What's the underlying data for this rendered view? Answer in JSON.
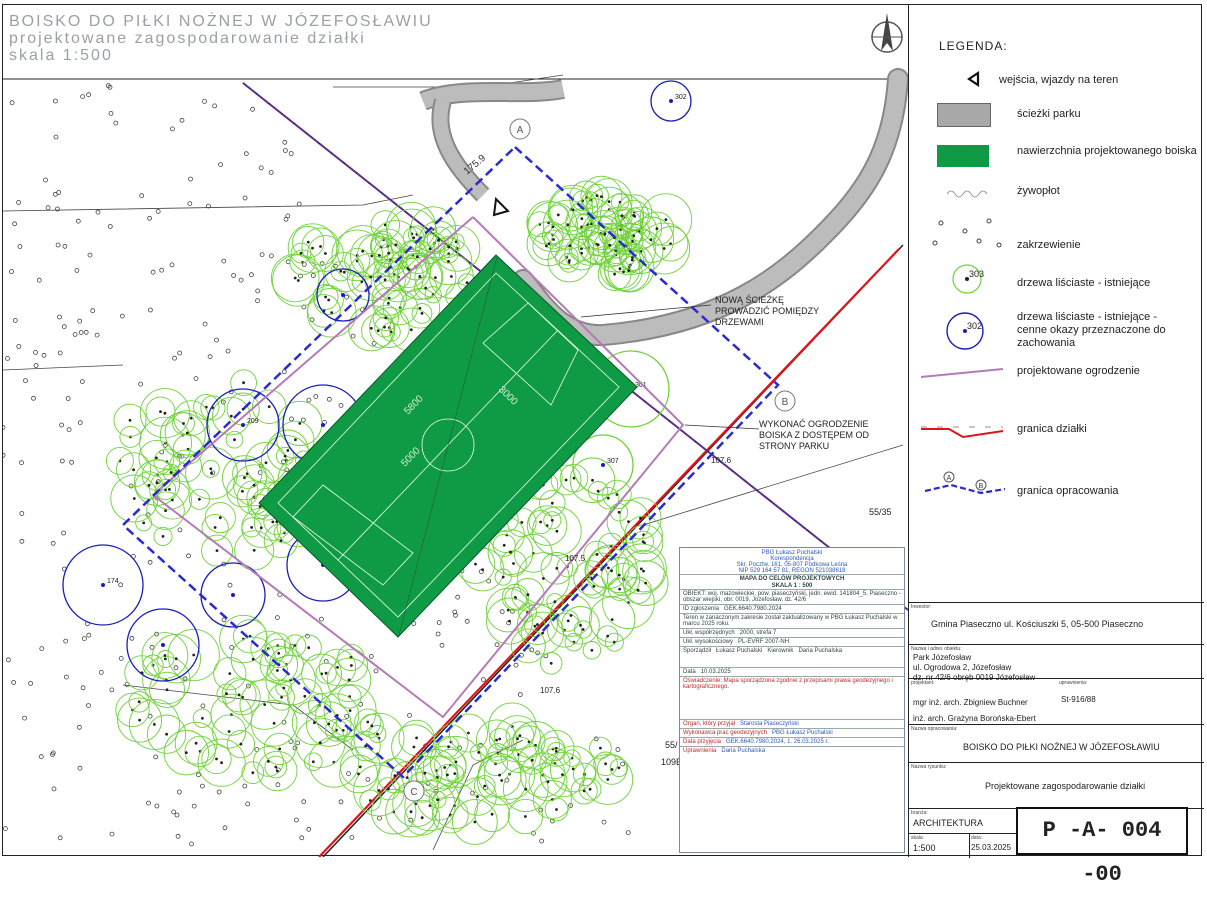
{
  "title": {
    "line1": "BOISKO DO PIŁKI NOŻNEJ W JÓZEFOSŁAWIU",
    "line2": "projektowane zagospodarowanie działki",
    "line3": "skala 1:500"
  },
  "legend": {
    "heading": "LEGENDA:",
    "items": [
      {
        "key": "entrance",
        "label": "wejścia, wjazdy na teren"
      },
      {
        "key": "paths",
        "label": "ścieżki parku"
      },
      {
        "key": "pitch",
        "label": "nawierzchnia projektowanego boiska"
      },
      {
        "key": "hedge",
        "label": "żywopłot"
      },
      {
        "key": "shrubs",
        "label": "zakrzewienie"
      },
      {
        "key": "trees",
        "label": "drzewa liściaste - istniejące",
        "number": "303"
      },
      {
        "key": "valuable_trees",
        "label": "drzewa liściaste - istniejące - cenne okazy przeznaczone do zachowania",
        "number": "302"
      },
      {
        "key": "fence",
        "label": "projektowane ogrodzenie"
      },
      {
        "key": "boundary",
        "label": "granica działki"
      },
      {
        "key": "study_area",
        "label": "granica opracowania",
        "marker_a": "A",
        "marker_b": "B"
      }
    ]
  },
  "annotations": {
    "new_path": "NOWĄ ŚCIEŻKĘ PROWADZIĆ POMIĘDZY DRZEWAMI",
    "fence_note": "WYKONAĆ OGRODZENIE BOISKA Z DOSTĘPEM OD STRONY PARKU",
    "plot_1": "55/35",
    "plot_2": "55/",
    "plot_3": "109E",
    "level_1": "107.6",
    "level_2": "107.6",
    "level_3": "107.5",
    "dim_1": "5000",
    "dim_2": "5800",
    "dim_3": "3000",
    "dim_4": "175.9",
    "marker_a": "A",
    "marker_b": "B",
    "marker_c": "C",
    "tree_302": "302",
    "tree_301": "301",
    "tree_307": "307",
    "tree_209": "209",
    "tree_174": "174"
  },
  "survey_panel": {
    "company": "PBG Łukasz Puchalski",
    "company2": "Korespondencja",
    "address": "Skr. Pocztw. 161, 05-807 Podkowa Leśna",
    "nip": "NIP 529 164 57 81, REGON 521038618",
    "map_title": "MAPA DO CELÓW PROJEKTOWYCH",
    "scale": "SKALA 1 : 500",
    "object_label": "OBIEKT:",
    "object_text": "woj. mazowieckie, pow. piaseczyński, jedn. ewid. 141804_5, Piaseczno - obszar wiejski, obr. 0019, Józefosław, dz. 42/6",
    "id_label": "ID zgłoszenia",
    "id_value": "GEK.6640.7980.2024",
    "survey_note": "Teren w zanaczonym zakresie został zaktualizowany w PBG Łukasz Puchalski w marcu 2025 roku.",
    "coords_label": "Ukł. współrzędnych",
    "coords_value": "2000, strefa 7",
    "height_label": "Ukł. wysokościowy",
    "height_value": "PL-EVRF 2007-NH",
    "prepared_label": "Sporządził",
    "prepared_name": "Łukasz Puchalski",
    "manager_label": "Kierownik",
    "manager_name": "Daria Puchalska",
    "date_label": "Data",
    "date_value": "10.03.2025",
    "red_note": "Oświadczenie: Mapa sporządzona zgodnie z przepisami prawa geodezyjnego i kartograficznego.",
    "authority_label": "Organ, który przyjął",
    "authority_value": "Starosta Piaseczyński",
    "office_label": "Wykonawca prac geodezyjnych",
    "office_value": "PBG Łukasz Puchalski",
    "doc_label": "Data przyjęcia",
    "doc_value": "GEK.6640.7980.2024, 1. 26.03.2025 r.",
    "rights_label": "Uprawnienia",
    "rights_value": "Daria Puchalska"
  },
  "side_block": {
    "investor_label": "Inwestor:",
    "investor": "Gmina Piaseczno ul. Kościuszki 5, 05-500 Piaseczno",
    "site_label": "Nazwa i adres obiektu:",
    "site_1": "Park Józefosław",
    "site_2": "ul. Ogrodowa 2, Józefosław",
    "site_3": "dz. nr 42/6 obręb 0019 Józefosław",
    "designers_label": "projektant:",
    "designer_1": "mgr inż. arch. Zbigniew Buchner",
    "designer_2": "inż. arch. Grażyna Borońska-Ebert",
    "license_label": "uprawnienia:",
    "license_1": "St-916/88",
    "study_label": "Nazwa opracowania:",
    "study_name": "BOISKO DO PIŁKI NOŻNEJ W JÓZEFOSŁAWIU",
    "drawing_label": "Nazwa rysunku:",
    "drawing_name": "Projektowane zagospodarowanie działki",
    "branch_label": "branża:",
    "branch": "ARCHITEKTURA",
    "scale_label": "skala:",
    "scale": "1:500",
    "date_label": "data:",
    "date": "25.03.2025",
    "code": "P -A- 004 -00"
  },
  "colors": {
    "pitch": "#0f9a46",
    "tree": "#6fd23a",
    "valuable_tree": "#1a1fb8",
    "fence": "#b57ab8",
    "boundary": "#e0141a",
    "study": "#2a2ad0",
    "path": "#a8a8a8"
  }
}
